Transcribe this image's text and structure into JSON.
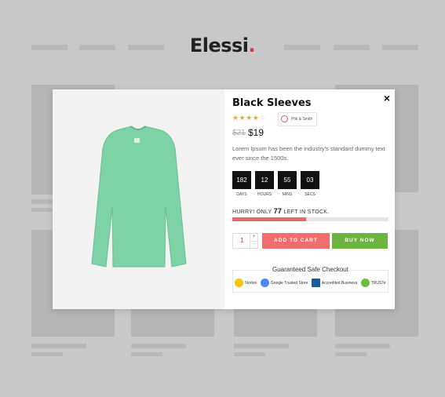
{
  "brand": {
    "name": "Elessi",
    "dot": "."
  },
  "product": {
    "title": "Black Sleeves",
    "rating": {
      "filled": 4,
      "total": 5
    },
    "vendor": "Phil & Smith",
    "old_price": "$21",
    "price": "$19",
    "description": "Lorem Ipsum has been the industry's standard dummy text ever since the 1500s.",
    "image_alt": "green sweater"
  },
  "countdown": [
    {
      "value": "182",
      "label": "DAYS"
    },
    {
      "value": "12",
      "label": "HOURS"
    },
    {
      "value": "55",
      "label": "MINS"
    },
    {
      "value": "03",
      "label": "SECS"
    }
  ],
  "stock": {
    "prefix": "HURRY! ONLY",
    "count": "77",
    "suffix": "LEFT IN STOCK.",
    "progress_fraction": 0.47
  },
  "cart": {
    "quantity": "1",
    "add_label": "ADD TO CART",
    "buy_label": "BUY NOW"
  },
  "checkout": {
    "title": "Guaranteed Safe Checkout",
    "badges": [
      "Norton",
      "Google Trusted Store",
      "Accredited Business",
      "TRUSTe"
    ]
  },
  "close_glyph": "×",
  "colors": {
    "accent": "#f06d6d",
    "buy": "#6db33f",
    "shirt": "#7dd3a5"
  }
}
